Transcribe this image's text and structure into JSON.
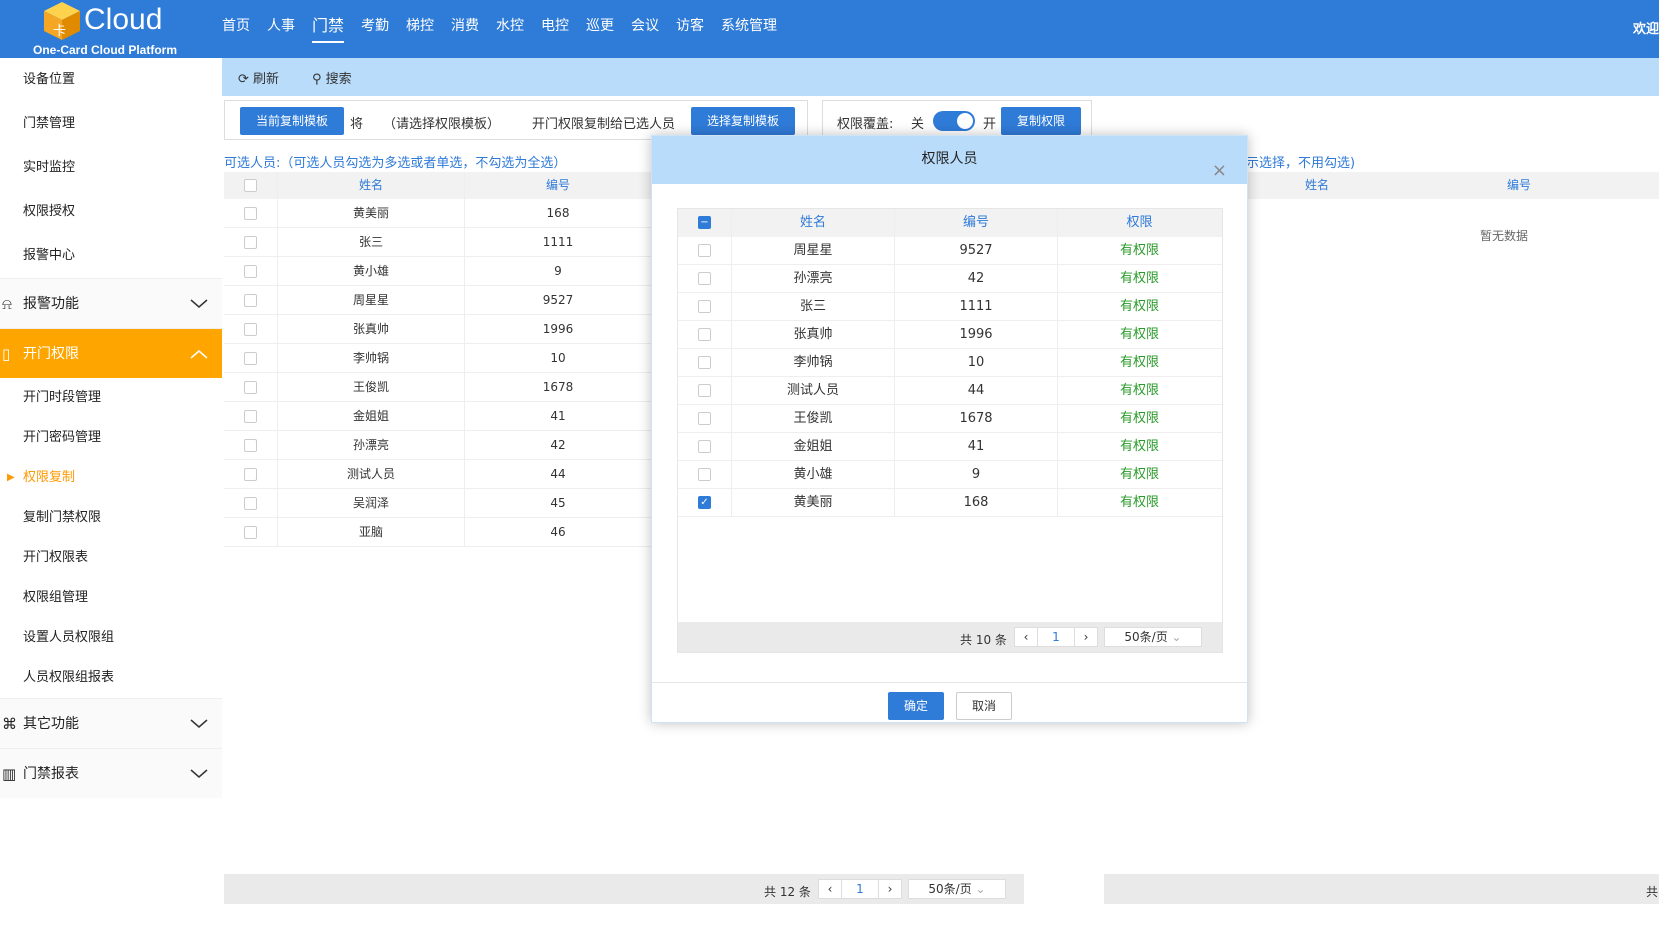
{
  "header": {
    "logo_text": "Cloud",
    "logo_cube_label": "卡",
    "logo_sub": "One-Card Cloud Platform",
    "nav": [
      "首页",
      "人事",
      "门禁",
      "考勤",
      "梯控",
      "消费",
      "水控",
      "电控",
      "巡更",
      "会议",
      "访客",
      "系统管理"
    ],
    "nav_active": "门禁",
    "welcome": "欢迎"
  },
  "sidebar": {
    "items_top": [
      "设备位置",
      "门禁管理",
      "实时监控",
      "权限授权",
      "报警中心"
    ],
    "group_alarm": "报警功能",
    "group_door": "开门权限",
    "sub_items": [
      "开门时段管理",
      "开门密码管理",
      "权限复制",
      "复制门禁权限",
      "开门权限表",
      "权限组管理",
      "设置人员权限组",
      "人员权限组报表"
    ],
    "current_sub": "权限复制",
    "group_other": "其它功能",
    "group_report": "门禁报表"
  },
  "toolbar": {
    "refresh": "刷新",
    "search": "搜索"
  },
  "copy_panel": {
    "current_template_btn": "当前复制模板",
    "jiang": "将",
    "select_hint": "（请选择权限模板）",
    "copy_text": "开门权限复制给已选人员",
    "select_template_btn": "选择复制模板",
    "override_label": "权限覆盖:",
    "off": "关",
    "on": "开",
    "copy_btn": "复制权限"
  },
  "left_table": {
    "hint": "可选人员:（可选人员勾选为多选或者单选，不勾选为全选）",
    "col_name": "姓名",
    "col_no": "编号",
    "rows": [
      {
        "name": "黄美丽",
        "no": "168"
      },
      {
        "name": "张三",
        "no": "1111"
      },
      {
        "name": "黄小雄",
        "no": "9"
      },
      {
        "name": "周星星",
        "no": "9527"
      },
      {
        "name": "张真帅",
        "no": "1996"
      },
      {
        "name": "李帅锅",
        "no": "10"
      },
      {
        "name": "王俊凯",
        "no": "1678"
      },
      {
        "name": "金姐姐",
        "no": "41"
      },
      {
        "name": "孙漂亮",
        "no": "42"
      },
      {
        "name": "测试人员",
        "no": "44"
      },
      {
        "name": "吴润泽",
        "no": "45"
      },
      {
        "name": "亚脑",
        "no": "46"
      }
    ],
    "total": "共 12 条",
    "page": "1",
    "page_size": "50条/页"
  },
  "right_table": {
    "hint": "示选择，不用勾选)",
    "col_name": "姓名",
    "col_no": "编号",
    "empty": "暂无数据",
    "total_partial": "共"
  },
  "modal": {
    "title": "权限人员",
    "close": "×",
    "col_name": "姓名",
    "col_no": "编号",
    "col_perm": "权限",
    "rows": [
      {
        "name": "周星星",
        "no": "9527",
        "perm": "有权限",
        "checked": false
      },
      {
        "name": "孙漂亮",
        "no": "42",
        "perm": "有权限",
        "checked": false
      },
      {
        "name": "张三",
        "no": "1111",
        "perm": "有权限",
        "checked": false
      },
      {
        "name": "张真帅",
        "no": "1996",
        "perm": "有权限",
        "checked": false
      },
      {
        "name": "李帅锅",
        "no": "10",
        "perm": "有权限",
        "checked": false
      },
      {
        "name": "测试人员",
        "no": "44",
        "perm": "有权限",
        "checked": false
      },
      {
        "name": "王俊凯",
        "no": "1678",
        "perm": "有权限",
        "checked": false
      },
      {
        "name": "金姐姐",
        "no": "41",
        "perm": "有权限",
        "checked": false
      },
      {
        "name": "黄小雄",
        "no": "9",
        "perm": "有权限",
        "checked": false
      },
      {
        "name": "黄美丽",
        "no": "168",
        "perm": "有权限",
        "checked": true
      }
    ],
    "total": "共 10 条",
    "page": "1",
    "page_size": "50条/页",
    "ok": "确定",
    "cancel": "取消"
  },
  "colors": {
    "primary": "#2f7bd8",
    "accent_orange": "#ffa500",
    "perm_green": "#2a9a2a",
    "toolbar_bg": "#b9dcfb"
  }
}
